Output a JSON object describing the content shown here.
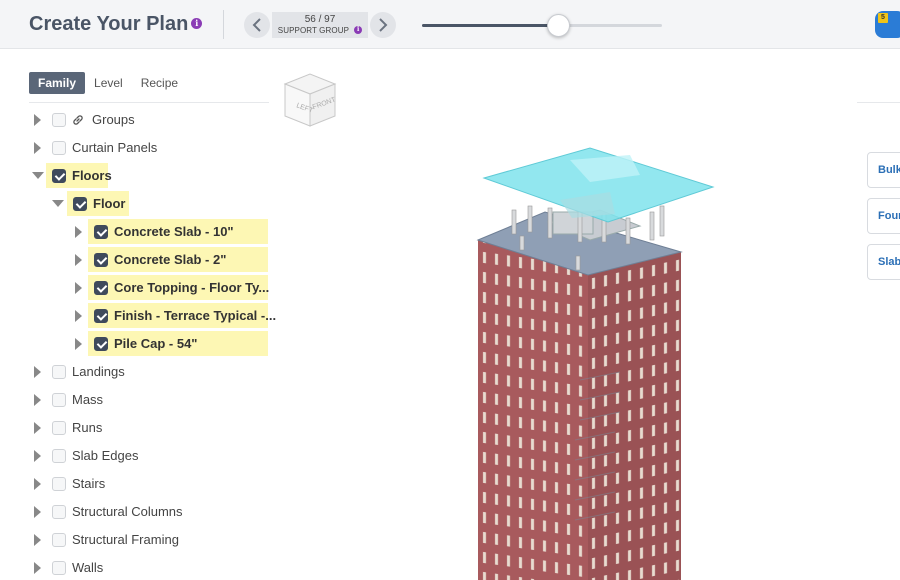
{
  "header": {
    "title": "Create Your Plan",
    "pager": {
      "count": "56 / 97",
      "label": "SUPPORT GROUP"
    },
    "slider": {
      "fraction": 0.567
    },
    "corner_badge": "5"
  },
  "tabs": [
    {
      "label": "Family",
      "active": true
    },
    {
      "label": "Level",
      "active": false
    },
    {
      "label": "Recipe",
      "active": false
    }
  ],
  "view_cube": {
    "left": "LEFT",
    "front": "FRONT"
  },
  "tree": [
    {
      "label": "Groups",
      "level": 0,
      "checked": false,
      "expanded": false,
      "icon": "link-icon"
    },
    {
      "label": "Curtain Panels",
      "level": 0,
      "checked": false,
      "expanded": false
    },
    {
      "label": "Floors",
      "level": 0,
      "checked": true,
      "expanded": true
    },
    {
      "label": "Floor",
      "level": 1,
      "checked": true,
      "expanded": true
    },
    {
      "label": "Concrete Slab - 10\"",
      "level": 2,
      "checked": true,
      "expanded": false
    },
    {
      "label": "Concrete Slab - 2\"",
      "level": 2,
      "checked": true,
      "expanded": false
    },
    {
      "label": "Core Topping - Floor Ty...",
      "level": 2,
      "checked": true,
      "expanded": false
    },
    {
      "label": "Finish - Terrace Typical -...",
      "level": 2,
      "checked": true,
      "expanded": false
    },
    {
      "label": "Pile Cap - 54\"",
      "level": 2,
      "checked": true,
      "expanded": false
    },
    {
      "label": "Landings",
      "level": 0,
      "checked": false,
      "expanded": false
    },
    {
      "label": "Mass",
      "level": 0,
      "checked": false,
      "expanded": false
    },
    {
      "label": "Runs",
      "level": 0,
      "checked": false,
      "expanded": false
    },
    {
      "label": "Slab Edges",
      "level": 0,
      "checked": false,
      "expanded": false
    },
    {
      "label": "Stairs",
      "level": 0,
      "checked": false,
      "expanded": false
    },
    {
      "label": "Structural Columns",
      "level": 0,
      "checked": false,
      "expanded": false
    },
    {
      "label": "Structural Framing",
      "level": 0,
      "checked": false,
      "expanded": false
    },
    {
      "label": "Walls",
      "level": 0,
      "checked": false,
      "expanded": false
    }
  ],
  "side_buttons": [
    "Bulk",
    "Four",
    "Slab"
  ],
  "colors": {
    "accent": "#5a6678",
    "highlight": "#fdf7b4",
    "checked": "#3f4a5c",
    "building_red": "#a85a5d",
    "slab_cyan": "#7fe3ec",
    "info": "#8a3bb5",
    "corner_button": "#2b7cd6"
  }
}
